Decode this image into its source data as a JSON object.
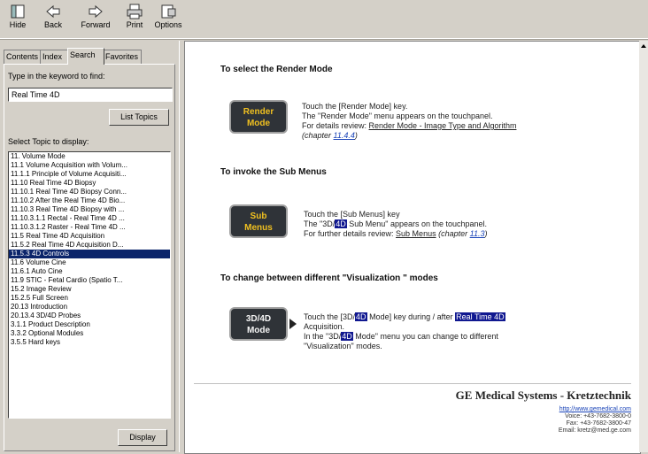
{
  "toolbar": {
    "hide": "Hide",
    "back": "Back",
    "forward": "Forward",
    "print": "Print",
    "options": "Options"
  },
  "left": {
    "tabs": [
      "Contents",
      "Index",
      "Search",
      "Favorites"
    ],
    "active_tab": "Search",
    "keyword_label": "Type in the keyword to find:",
    "keyword_value": "Real Time 4D",
    "list_topics_button": "List Topics",
    "select_topic_label": "Select Topic to display:",
    "topics": [
      "11. Volume Mode",
      "11.1 Volume Acquisition with Volum...",
      "11.1.1 Principle of Volume Acquisiti...",
      "11.10 Real Time 4D Biopsy",
      "11.10.1 Real Time 4D Biopsy Conn...",
      "11.10.2 After the Real Time 4D Bio...",
      "11.10.3 Real Time 4D Biopsy with ...",
      "11.10.3.1.1 Rectal - Real Time 4D ...",
      "11.10.3.1.2 Raster - Real Time 4D ...",
      "11.5 Real Time 4D Acquisition",
      "11.5.2 Real Time 4D Acquisition D...",
      "11.5.3 4D Controls",
      "11.6 Volume Cine",
      "11.6.1 Auto Cine",
      "11.9 STIC - Fetal Cardio (Spatio T...",
      "15.2 Image Review",
      "15.2.5 Full Screen",
      "20.13 Introduction",
      "20.13.4 3D/4D Probes",
      "3.1.1 Product Description",
      "3.3.2 Optional Modules",
      "3.5.5 Hard keys"
    ],
    "selected_topic_index": 11,
    "display_button": "Display"
  },
  "content": {
    "sections": [
      {
        "heading": "To select the Render Mode",
        "key_lines": [
          "Render",
          "Mode"
        ],
        "key_color": "#f0c020",
        "line1": "Touch the [Render Mode] key.",
        "line2": "The \"Render Mode\" menu appears on the touchpanel.",
        "line3_prefix": "For details review: ",
        "line3_link": "Render Mode - Image Type and Algorithm",
        "line4_prefix": "(chapter ",
        "line4_link": "11.4.4",
        "line4_suffix": ")"
      },
      {
        "heading": "To invoke the Sub Menus",
        "key_lines": [
          "Sub",
          "Menus"
        ],
        "key_color": "#f0c020",
        "line1": "Touch the [Sub Menus] key",
        "line2_prefix": "The \"3D/",
        "line2_hl": "4D",
        "line2_suffix": " Sub Menu\" appears on the touchpanel.",
        "line3_prefix": "For further details review: ",
        "line3_link": "Sub Menus",
        "line3_mid": " (chapter ",
        "line3_link2": "11.3",
        "line3_suffix": ")"
      },
      {
        "heading": "To change between different \"Visualization \" modes",
        "key_lines": [
          "3D/4D",
          "Mode"
        ],
        "key_color": "#f4f4f4",
        "line1_prefix": "Touch the [3D/",
        "line1_hl": "4D",
        "line1_mid": " Mode] key during / after ",
        "line1_hl2": "Real Time 4D",
        "line2": "Acquisition.",
        "line3_prefix": "In the \"3D/",
        "line3_hl": "4D",
        "line3_suffix": " Mode\" menu you can change to different",
        "line4": "\"Visualization\" modes."
      }
    ],
    "footer": {
      "company": "GE Medical Systems - Kretztechnik",
      "link": "http://www.gemedical.com",
      "voice": "Voice: +43-7682-3800-0",
      "fax": "Fax: +43-7682-3800-47",
      "email": "Email: kretz@med.ge.com"
    }
  }
}
